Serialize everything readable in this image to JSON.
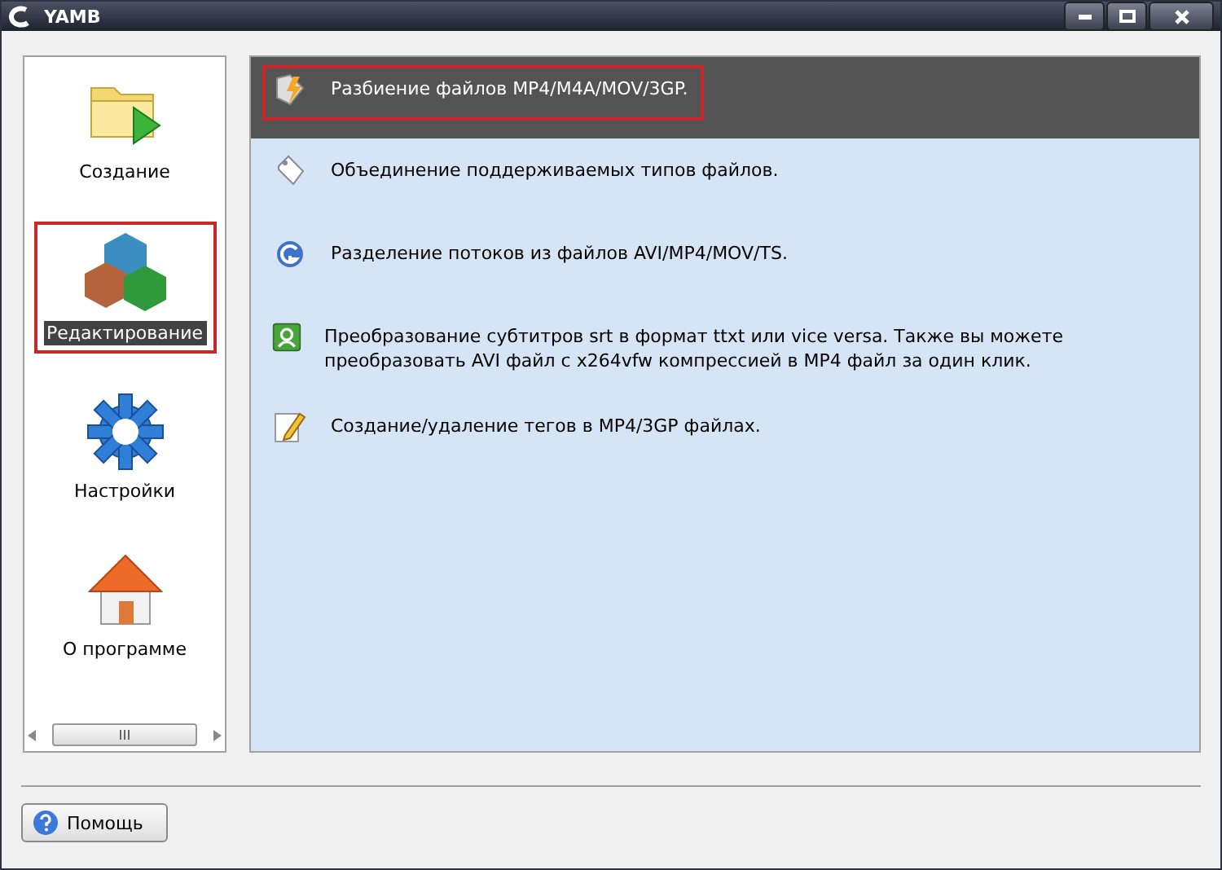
{
  "window": {
    "title": "YAMB"
  },
  "sidebar": {
    "items": [
      {
        "kind": "create",
        "label": "Создание",
        "selected": false,
        "annotated": false
      },
      {
        "kind": "edit",
        "label": "Редактирование",
        "selected": true,
        "annotated": true
      },
      {
        "kind": "settings",
        "label": "Настройки",
        "selected": false,
        "annotated": false
      },
      {
        "kind": "about",
        "label": "О программе",
        "selected": false,
        "annotated": false
      }
    ]
  },
  "tasks": [
    {
      "kind": "split",
      "label": "Разбиение файлов MP4/M4A/MOV/3GP.",
      "selected": true,
      "annotated": true
    },
    {
      "kind": "join",
      "label": "Объединение поддерживаемых типов файлов.",
      "selected": false,
      "annotated": false
    },
    {
      "kind": "demux",
      "label": "Разделение потоков из файлов AVI/MP4/MOV/TS.",
      "selected": false,
      "annotated": false
    },
    {
      "kind": "convert",
      "label": "Преобразование субтитров srt в формат ttxt или vice versa. Также вы можете преобразовать AVI файл с x264vfw компрессией в MP4 файл за один клик.",
      "selected": false,
      "annotated": false
    },
    {
      "kind": "tags",
      "label": "Создание/удаление тегов в MP4/3GP файлах.",
      "selected": false,
      "annotated": false
    }
  ],
  "help_button": {
    "label": "Помощь"
  }
}
